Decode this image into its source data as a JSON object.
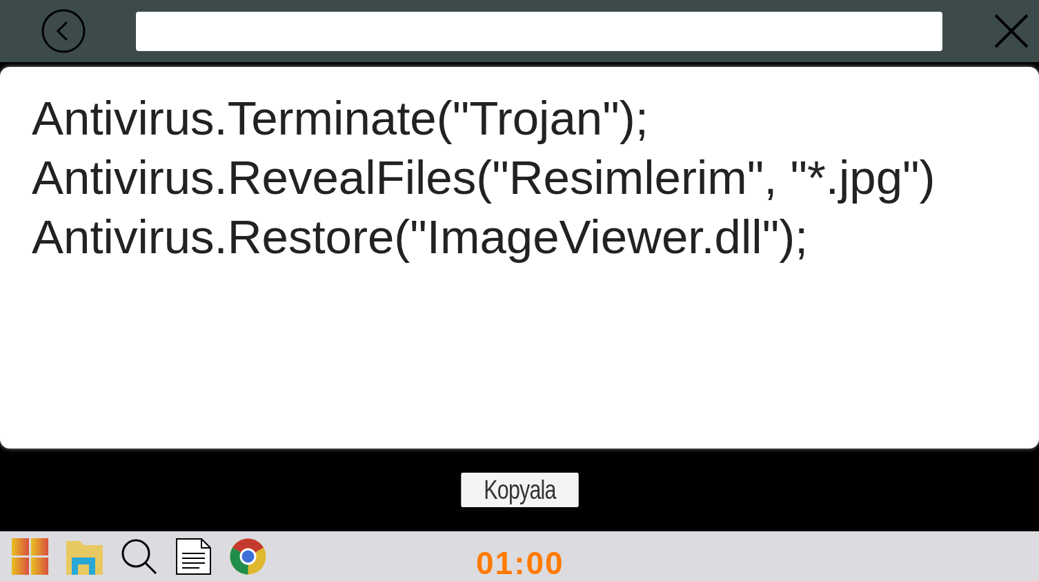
{
  "code_lines": [
    "Antivirus.Terminate(\"Trojan\");",
    "Antivirus.RevealFiles(\"Resimlerim\", \"*.jpg\")",
    "Antivirus.Restore(\"ImageViewer.dll\");"
  ],
  "copy_button": {
    "label": "Kopyala"
  },
  "taskbar": {
    "clock": "01:00"
  }
}
